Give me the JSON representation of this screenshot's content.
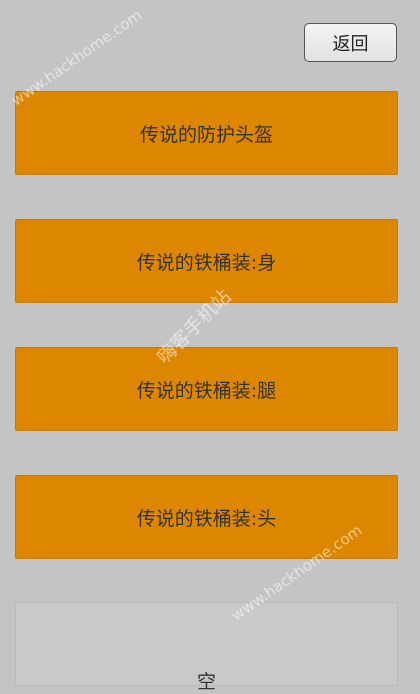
{
  "header": {
    "back_label": "返回"
  },
  "items": [
    {
      "label": "传说的防护头盔"
    },
    {
      "label": "传说的铁桶装:身"
    },
    {
      "label": "传说的铁桶装:腿"
    },
    {
      "label": "传说的铁桶装:头"
    },
    {
      "label": "空"
    }
  ],
  "watermarks": {
    "url_top": "www.hackhome.com",
    "site_name": "嗨客手机站",
    "url_bottom": "www.hackhome.com"
  }
}
